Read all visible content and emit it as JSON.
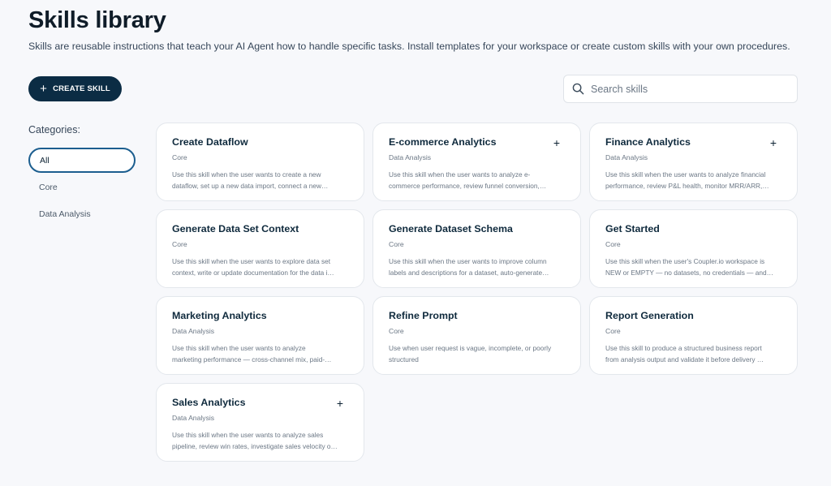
{
  "header": {
    "title": "Skills library",
    "subtitle": "Skills are reusable instructions that teach your AI Agent how to handle specific tasks. Install templates for your workspace or create custom skills with your own procedures."
  },
  "toolbar": {
    "create_label": "CREATE SKILL"
  },
  "search": {
    "placeholder": "Search skills",
    "value": ""
  },
  "sidebar": {
    "label": "Categories:",
    "items": [
      {
        "label": "All",
        "active": true
      },
      {
        "label": "Core"
      },
      {
        "label": "Data Analysis"
      }
    ]
  },
  "cards": [
    {
      "title": "Create Dataflow",
      "category": "Core",
      "desc1": "Use this skill when the user wants to create a new",
      "desc2": "dataflow, set up a new data import, connect a new…",
      "addable": false
    },
    {
      "title": "E-commerce Analytics",
      "category": "Data Analysis",
      "desc1": "Use this skill when the user wants to analyze e-",
      "desc2": "commerce performance, review funnel conversion,…",
      "addable": true
    },
    {
      "title": "Finance Analytics",
      "category": "Data Analysis",
      "desc1": "Use this skill when the user wants to analyze financial",
      "desc2": "performance, review P&L health, monitor MRR/ARR,…",
      "addable": true
    },
    {
      "title": "Generate Data Set Context",
      "category": "Core",
      "desc1": "Use this skill when the user wants to explore data set",
      "desc2": "context, write or update documentation for the data i…",
      "addable": false
    },
    {
      "title": "Generate Dataset Schema",
      "category": "Core",
      "desc1": "Use this skill when the user wants to improve column",
      "desc2": "labels and descriptions for a dataset, auto-generate…",
      "addable": false
    },
    {
      "title": "Get Started",
      "category": "Core",
      "desc1": "Use this skill when the user's Coupler.io workspace is",
      "desc2": "NEW or EMPTY — no datasets, no credentials — and…",
      "addable": false
    },
    {
      "title": "Marketing Analytics",
      "category": "Data Analysis",
      "desc1": "Use this skill when the user wants to analyze",
      "desc2": "marketing performance — cross-channel mix, paid-…",
      "addable": false
    },
    {
      "title": "Refine Prompt",
      "category": "Core",
      "desc1": "Use when user request is vague, incomplete, or poorly",
      "desc2": "structured",
      "addable": false
    },
    {
      "title": "Report Generation",
      "category": "Core",
      "desc1": "Use this skill to produce a structured business report",
      "desc2": "from analysis output and validate it before delivery …",
      "addable": false
    },
    {
      "title": "Sales Analytics",
      "category": "Data Analysis",
      "desc1": "Use this skill when the user wants to analyze sales",
      "desc2": "pipeline, review win rates, investigate sales velocity o…",
      "addable": true
    }
  ],
  "icons": {
    "search": "search-icon",
    "plus": "plus-icon"
  },
  "colors": {
    "primary": "#0b2c44",
    "active_border": "#1c5e8f",
    "background": "#f7f8fb"
  }
}
